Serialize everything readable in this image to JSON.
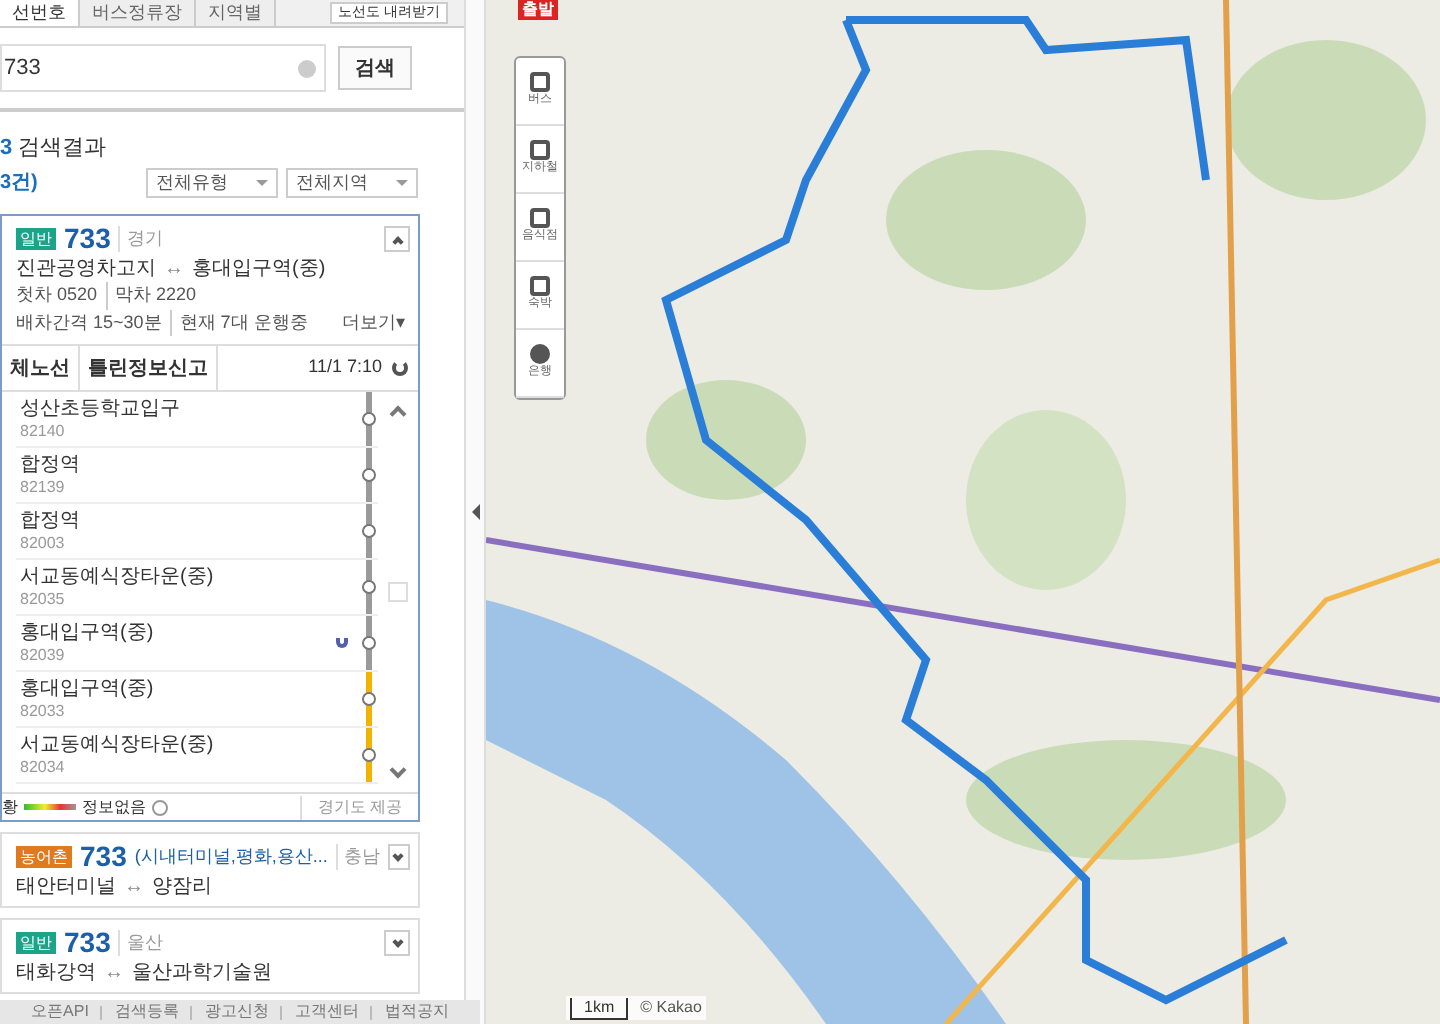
{
  "tabs": [
    {
      "label": "선번호",
      "selected": true
    },
    {
      "label": "버스정류장",
      "selected": false
    },
    {
      "label": "지역별",
      "selected": false
    }
  ],
  "tab_button": "노선도 내려받기",
  "search": {
    "value": "733",
    "button": "검색"
  },
  "result_title": {
    "query": "3",
    "text": "검색결과"
  },
  "result_count": "3건)",
  "filters": [
    "전체유형",
    "전체지역"
  ],
  "routes": [
    {
      "type": "일반",
      "color": "#1aa58b",
      "number": "733",
      "region": "경기",
      "from": "진관공영차고지",
      "arrow": "↔",
      "to": "홍대입구역(중)",
      "expanded": true,
      "first_last": "첫차 0520",
      "last": "막차 2220",
      "interval": "배차간격 15~30분",
      "running": "현재 7대 운행중",
      "more": "더보기▾",
      "detail_tabs": [
        "체노선",
        "틀린정보신고"
      ],
      "updated": "11/1 7:10",
      "stops": [
        {
          "name": "성산초등학교입구",
          "id": "82140",
          "color": "#9a9a9a",
          "bus": false
        },
        {
          "name": "합정역",
          "id": "82139",
          "color": "#9a9a9a",
          "bus": false
        },
        {
          "name": "합정역",
          "id": "82003",
          "color": "#9a9a9a",
          "bus": false
        },
        {
          "name": "서교동예식장타운(중)",
          "id": "82035",
          "color": "#9a9a9a",
          "bus": false
        },
        {
          "name": "홍대입구역(중)",
          "id": "82039",
          "color": "#9a9a9a",
          "bus": true
        },
        {
          "name": "홍대입구역(중)",
          "id": "82033",
          "color": "#f0b400",
          "bus": false
        },
        {
          "name": "서교동예식장타운(중)",
          "id": "82034",
          "color": "#f0b400",
          "bus": false
        }
      ],
      "legend_start": "황",
      "legend_none": "정보없음",
      "provider": "경기도 제공"
    },
    {
      "type": "농어촌",
      "color": "#e07a1f",
      "number": "733",
      "name": "(시내터미널,평화,용산...",
      "region": "충남",
      "from": "태안터미널",
      "arrow": "↔",
      "to": "양잠리",
      "expanded": false
    },
    {
      "type": "일반",
      "color": "#1aa58b",
      "number": "733",
      "region": "울산",
      "from": "태화강역",
      "arrow": "↔",
      "to": "울산과학기술원",
      "expanded": false
    }
  ],
  "footer_links": [
    "오픈API",
    "검색등록",
    "광고신청",
    "고객센터",
    "법적공지"
  ],
  "map": {
    "start_badge": "출발",
    "tools": [
      "버스",
      "지하철",
      "음식점",
      "숙박",
      "은행"
    ],
    "scale": "1km",
    "copyright": "© Kakao"
  }
}
